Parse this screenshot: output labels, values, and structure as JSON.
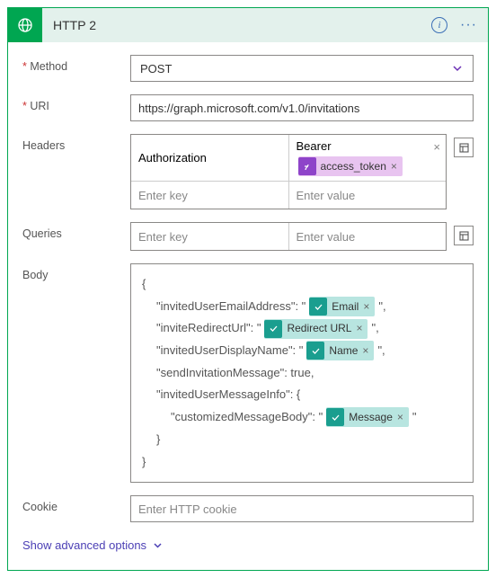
{
  "header": {
    "title": "HTTP 2"
  },
  "labels": {
    "method": "Method",
    "uri": "URI",
    "headers": "Headers",
    "queries": "Queries",
    "body": "Body",
    "cookie": "Cookie"
  },
  "method": {
    "value": "POST"
  },
  "uri": "https://graph.microsoft.com/v1.0/invitations",
  "headers_kv": {
    "row0": {
      "key": "Authorization",
      "value_prefix": "Bearer",
      "token": "access_token"
    },
    "row1": {
      "key_ph": "Enter key",
      "val_ph": "Enter value"
    }
  },
  "queries_kv": {
    "key_ph": "Enter key",
    "val_ph": "Enter value"
  },
  "body_json": {
    "l0": "{",
    "l1_pre": "\"invitedUserEmailAddress\": \"",
    "l1_token": "Email",
    "l1_post": "\",",
    "l2_pre": "\"inviteRedirectUrl\": \"",
    "l2_token": "Redirect URL",
    "l2_post": "\",",
    "l3_pre": "\"invitedUserDisplayName\": \"",
    "l3_token": "Name",
    "l3_post": "\",",
    "l4": "\"sendInvitationMessage\": true,",
    "l5": "\"invitedUserMessageInfo\": {",
    "l6_pre": "\"customizedMessageBody\": \"",
    "l6_token": "Message",
    "l6_post": "\"",
    "l7": "}",
    "l8": "}"
  },
  "cookie_ph": "Enter HTTP cookie",
  "advanced_link": "Show advanced options"
}
